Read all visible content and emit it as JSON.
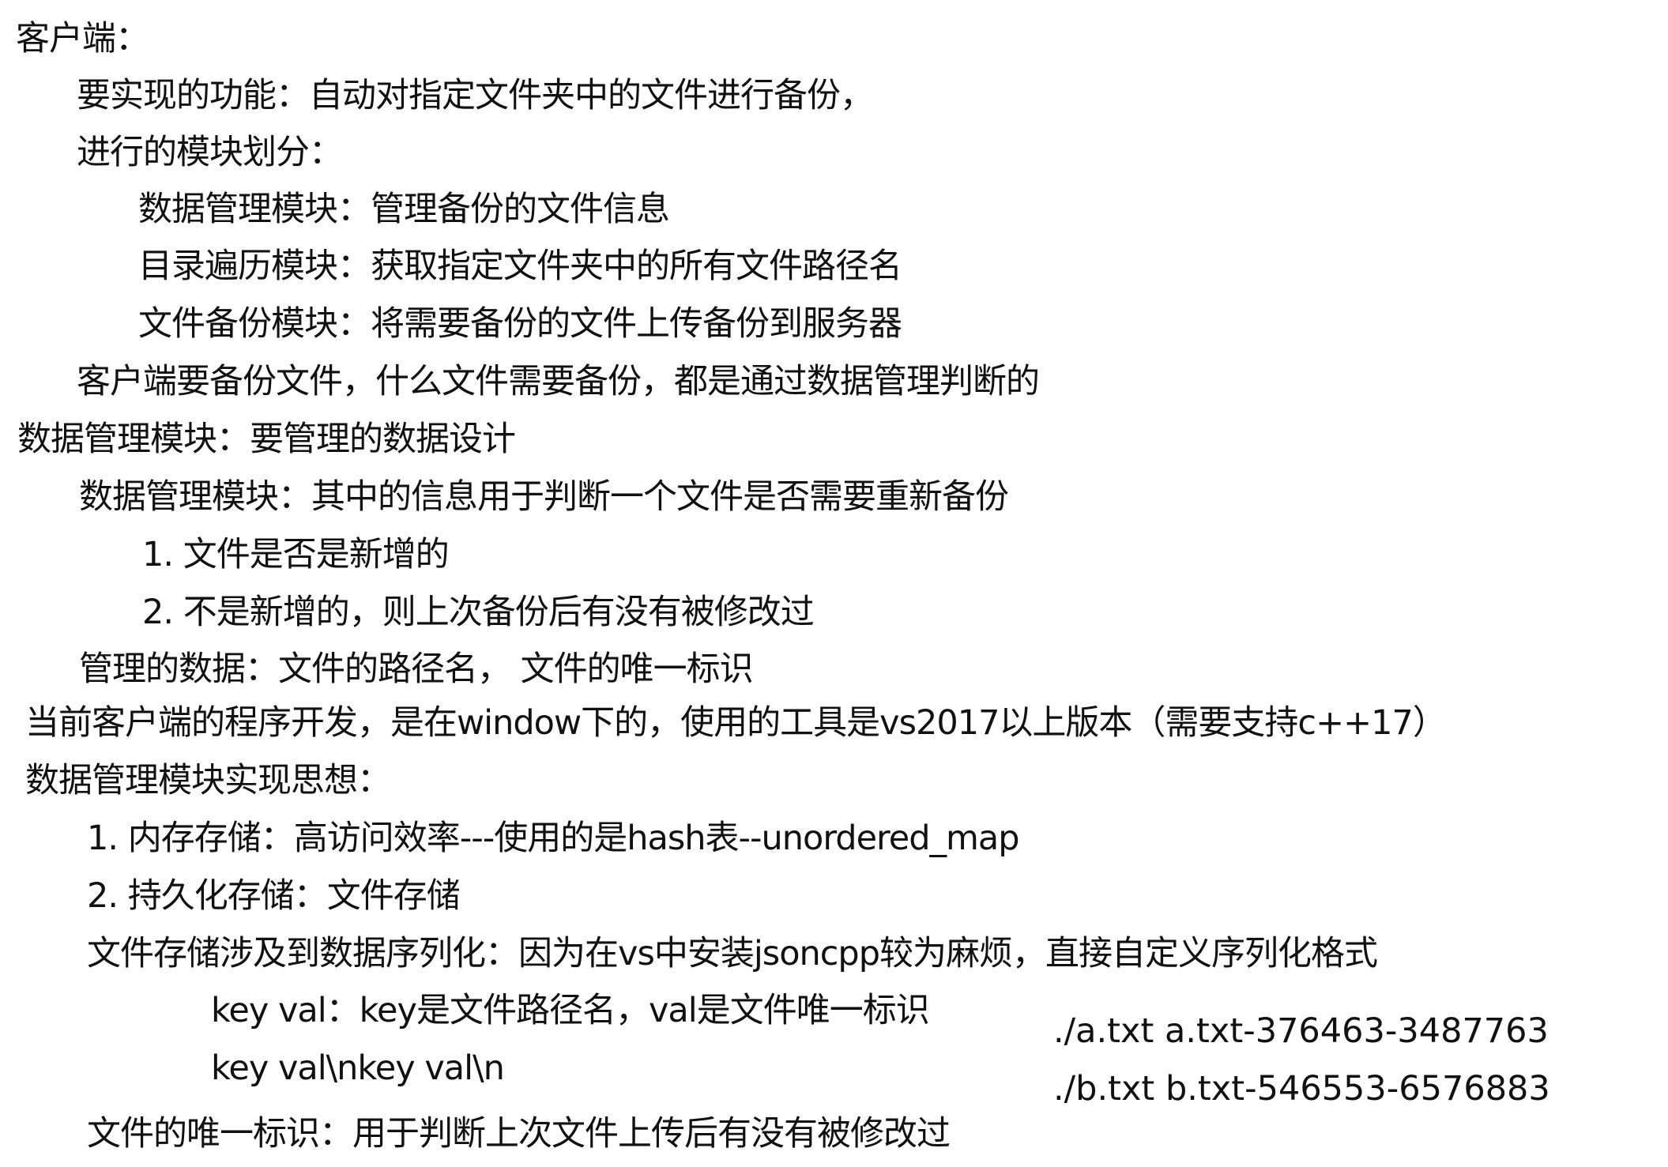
{
  "notes": {
    "l1": "客户端：",
    "l2": "要实现的功能：自动对指定文件夹中的文件进行备份，",
    "l3": "进行的模块划分：",
    "l4": "数据管理模块：管理备份的文件信息",
    "l5": "目录遍历模块：获取指定文件夹中的所有文件路径名",
    "l6": "文件备份模块：将需要备份的文件上传备份到服务器",
    "l7": "客户端要备份文件，什么文件需要备份，都是通过数据管理判断的",
    "l8": "数据管理模块：要管理的数据设计",
    "l9": "数据管理模块：其中的信息用于判断一个文件是否需要重新备份",
    "l10": "1. 文件是否是新增的",
    "l11": "2. 不是新增的，则上次备份后有没有被修改过",
    "l12": "管理的数据：文件的路径名， 文件的唯一标识",
    "l13": "当前客户端的程序开发，是在window下的，使用的工具是vs2017以上版本（需要支持c++17）",
    "l14": "数据管理模块实现思想：",
    "l15": "1. 内存存储：高访问效率---使用的是hash表--unordered_map",
    "l16": "2. 持久化存储：文件存储",
    "l17": "文件存储涉及到数据序列化：因为在vs中安装jsoncpp较为麻烦，直接自定义序列化格式",
    "l18": "key val：key是文件路径名，val是文件唯一标识",
    "l19": "key val\\nkey val\\n",
    "l20": "文件的唯一标识：用于判断上次文件上传后有没有被修改过"
  },
  "example": {
    "row1": "./a.txt a.txt-376463-3487763",
    "row2": "./b.txt b.txt-546553-6576883"
  }
}
